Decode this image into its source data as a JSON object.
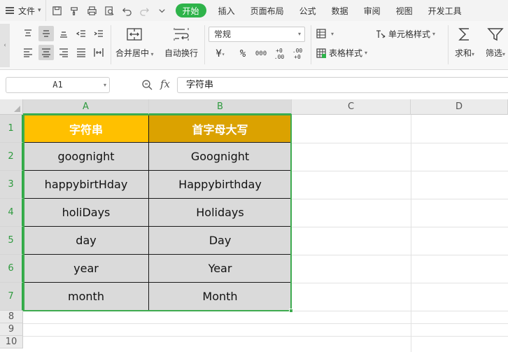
{
  "menubar": {
    "file_label": "文件",
    "tabs": [
      {
        "label": "开始",
        "active": true
      },
      {
        "label": "插入"
      },
      {
        "label": "页面布局"
      },
      {
        "label": "公式"
      },
      {
        "label": "数据"
      },
      {
        "label": "审阅"
      },
      {
        "label": "视图"
      },
      {
        "label": "开发工具"
      }
    ]
  },
  "ribbon": {
    "merge_center": "合并居中",
    "wrap_text": "自动换行",
    "number_format": "常规",
    "currency": "¥",
    "percent": "%",
    "thousands": "000",
    "inc_decimal": "+0 .00",
    "dec_decimal": ".00 +0",
    "cell_style": "单元格样式",
    "table_style": "表格样式",
    "sum": "求和",
    "filter": "筛选"
  },
  "formula_bar": {
    "name_box": "A1",
    "fx": "fx",
    "content": "字符串"
  },
  "sheet": {
    "columns": [
      "A",
      "B",
      "C",
      "D"
    ],
    "rows": [
      "1",
      "2",
      "3",
      "4",
      "5",
      "6",
      "7",
      "8",
      "9",
      "10"
    ],
    "headers": [
      "字符串",
      "首字母大写"
    ],
    "data": [
      [
        "goognight",
        "Goognight"
      ],
      [
        "happybirtHday",
        "Happybirthday"
      ],
      [
        "holiDays",
        "Holidays"
      ],
      [
        "day",
        "Day"
      ],
      [
        "year",
        "Year"
      ],
      [
        "month",
        "Month"
      ]
    ],
    "header_colors": [
      "#ffc000",
      "#dba200"
    ],
    "accent": "#2eb34a"
  }
}
